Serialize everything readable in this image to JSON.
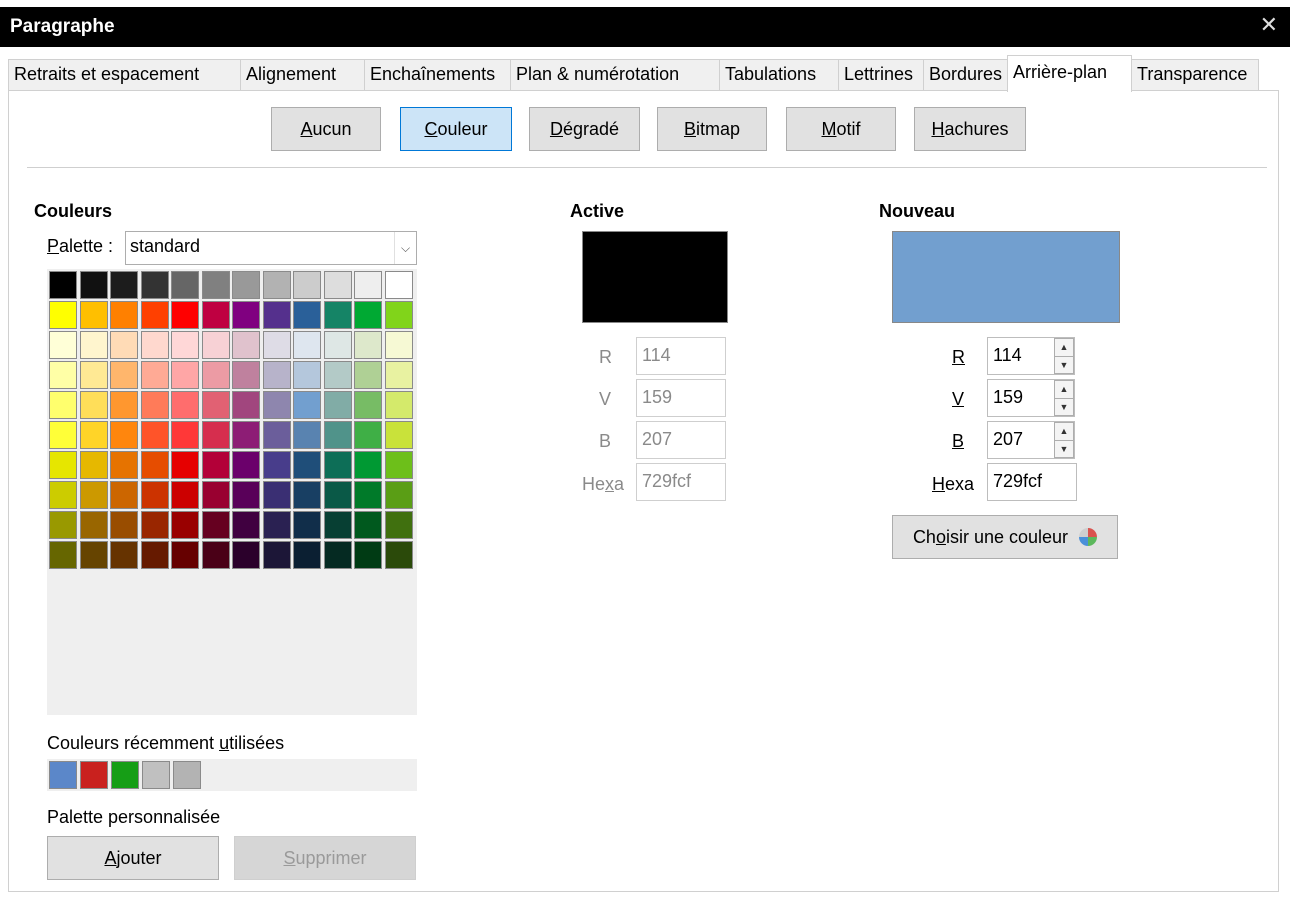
{
  "window": {
    "title": "Paragraphe",
    "close_glyph": "✕"
  },
  "tabs": [
    {
      "label": "Retraits et espacement",
      "active": false
    },
    {
      "label": "Alignement",
      "active": false
    },
    {
      "label": "Enchaînements",
      "active": false
    },
    {
      "label": "Plan & numérotation",
      "active": false
    },
    {
      "label": "Tabulations",
      "active": false
    },
    {
      "label": "Lettrines",
      "active": false
    },
    {
      "label": "Bordures",
      "active": false
    },
    {
      "label": "Arrière-plan",
      "active": true
    },
    {
      "label": "Transparence",
      "active": false
    }
  ],
  "fill_buttons": [
    {
      "first": "A",
      "rest": "ucun",
      "selected": false
    },
    {
      "first": "C",
      "rest": "ouleur",
      "selected": true
    },
    {
      "first": "D",
      "rest": "égradé",
      "selected": false
    },
    {
      "first": "B",
      "rest": "itmap",
      "selected": false
    },
    {
      "first": "M",
      "rest": "otif",
      "selected": false
    },
    {
      "first": "H",
      "rest": "achures",
      "selected": false
    }
  ],
  "colors": {
    "heading": "Couleurs",
    "palette_label_first": "P",
    "palette_label_rest": "alette :",
    "palette_value": "standard",
    "palette_swatches": [
      [
        "#000000",
        "#111111",
        "#1c1c1c",
        "#333333",
        "#666666",
        "#808080",
        "#999999",
        "#b2b2b2",
        "#cccccc",
        "#dddddd",
        "#eeeeee",
        "#ffffff"
      ],
      [
        "#ffff00",
        "#ffbf00",
        "#ff8000",
        "#ff4000",
        "#ff0000",
        "#bf0041",
        "#800080",
        "#55308d",
        "#2a6099",
        "#158466",
        "#00a933",
        "#81d41a"
      ],
      [
        "#ffffd7",
        "#fff5ce",
        "#ffdbb6",
        "#ffd8ce",
        "#ffd7d7",
        "#f7d1d5",
        "#e0c2cd",
        "#dedce6",
        "#dee6ef",
        "#dee7e5",
        "#dde8cb",
        "#f6f9d4"
      ],
      [
        "#ffffa6",
        "#ffe994",
        "#ffb66c",
        "#ffaa95",
        "#ffa6a6",
        "#ec9ba4",
        "#bf819e",
        "#b7b3ca",
        "#b4c7dc",
        "#b3cac7",
        "#afd095",
        "#e8f2a1"
      ],
      [
        "#ffff6d",
        "#ffde59",
        "#ff972f",
        "#ff7b59",
        "#ff6d6d",
        "#e16173",
        "#a1467e",
        "#8e86ae",
        "#729fcf",
        "#81aca6",
        "#77bc65",
        "#d4ea6b"
      ],
      [
        "#ffff38",
        "#ffd428",
        "#ff860d",
        "#ff5429",
        "#ff3838",
        "#d62e4e",
        "#8d1d75",
        "#6b5e9b",
        "#5983b0",
        "#50938a",
        "#3faf46",
        "#c9e23a"
      ],
      [
        "#e6e600",
        "#e6b800",
        "#e67300",
        "#e64d00",
        "#e60000",
        "#b30038",
        "#6b006b",
        "#483d8b",
        "#1f4e79",
        "#0d6e57",
        "#009933",
        "#6dbf1a"
      ],
      [
        "#cccc00",
        "#cc9900",
        "#cc6600",
        "#cc3300",
        "#cc0000",
        "#990030",
        "#590059",
        "#3a2f73",
        "#183f63",
        "#0a5947",
        "#007a29",
        "#5a9e15"
      ],
      [
        "#999900",
        "#996600",
        "#994d00",
        "#992600",
        "#990000",
        "#660020",
        "#400040",
        "#2a2152",
        "#112e4a",
        "#073f33",
        "#00591e",
        "#40700f"
      ],
      [
        "#666600",
        "#664400",
        "#663300",
        "#661a00",
        "#660000",
        "#4a0017",
        "#2b002b",
        "#1c1637",
        "#0b1f32",
        "#052a22",
        "#003b14",
        "#2b4a0a"
      ]
    ],
    "recent_label_pre": "Couleurs récemment ",
    "recent_label_u": "u",
    "recent_label_post": "tilisées",
    "recent_swatches": [
      "#5b87c9",
      "#c9211e",
      "#169e16",
      "#c0c0c0",
      "#b3b3b3"
    ],
    "custom_label": "Palette personnalisée",
    "add_first": "A",
    "add_rest": "jouter",
    "delete_first": "S",
    "delete_rest": "upprimer"
  },
  "active": {
    "heading": "Active",
    "preview_color": "#000000",
    "r_label": "R",
    "r_value": "114",
    "v_label": "V",
    "v_value": "159",
    "b_label": "B",
    "b_value": "207",
    "hex_label_pre": "He",
    "hex_label_u": "x",
    "hex_label_post": "a",
    "hex_value": "729fcf"
  },
  "new": {
    "heading": "Nouveau",
    "preview_color": "#729fcf",
    "r_label": "R",
    "r_value": "114",
    "v_label": "V",
    "v_value": "159",
    "b_label": "B",
    "b_value": "207",
    "hex_label_first": "H",
    "hex_label_rest": "exa",
    "hex_value": "729fcf",
    "pick_pre": "Ch",
    "pick_u": "o",
    "pick_post": "isir une couleur",
    "pick_icon": "color-wheel-icon"
  }
}
